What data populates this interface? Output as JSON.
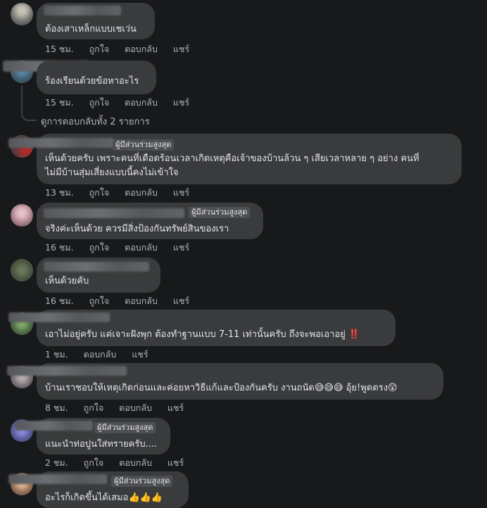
{
  "comments": [
    {
      "text_lines": [
        "ต้องเสาเหล็กแบบเชเว่น"
      ],
      "time": "15 ชม.",
      "like": "ถูกใจ",
      "reply": "ตอบกลับ",
      "share": "แชร์"
    },
    {
      "text_lines": [
        "ร้องเรียนด้วยข้อหาอะไร"
      ],
      "time": "15 ชม.",
      "like": "ถูกใจ",
      "reply": "ตอบกลับ",
      "share": "แชร์",
      "view_replies": "ดูการตอบกลับทั้ง 2 รายการ"
    },
    {
      "badge": "ผู้มีส่วนร่วมสูงสุด",
      "text_lines": [
        "เห็นด้วยครับ เพราะคนที่เดือดร้อนเวลาเกิดเหตุคือเจ้าของบ้านล้วน ๆ เสียเวลาหลาย ๆ อย่าง คนที่",
        "ไม่มีบ้านสุ่มเสี่ยงแบบนี้คงไม่เข้าใจ"
      ],
      "time": "13 ชม.",
      "like": "ถูกใจ",
      "reply": "ตอบกลับ",
      "share": "แชร์"
    },
    {
      "badge": "ผู้มีส่วนร่วมสูงสุด",
      "text_lines": [
        "จริงค่ะเห็นด้วย ควรมีสิ่งป้องกันทรัพย์สินของเรา"
      ],
      "time": "16 ชม.",
      "like": "ถูกใจ",
      "reply": "ตอบกลับ",
      "share": "แชร์"
    },
    {
      "text_lines": [
        "เห็นด้วยคับ"
      ],
      "time": "16 ชม.",
      "like": "ถูกใจ",
      "reply": "ตอบกลับ",
      "share": "แชร์"
    },
    {
      "text_lines": [
        "เอาไม่อยู่ครับ แค่เจาะฝังพุก ต้องทำฐานแบบ 7-11 เท่านั้นครับ ถึงจะพอเอาอยู่ ‼️"
      ],
      "time": "1 ชม.",
      "like": "",
      "reply": "ตอบกลับ",
      "share": "แชร์"
    },
    {
      "text_lines": [
        "บ้านเราชอบให้เหตุเกิดก่อนและค่อยหาวิธีแก้และป้องกันครับ งานถนัด😅😅😅 อุ้ย!พูดตรง😲"
      ],
      "time": "8 ชม.",
      "like": "ถูกใจ",
      "reply": "ตอบกลับ",
      "share": "แชร์"
    },
    {
      "badge": "ผู้มีส่วนร่วมสูงสุด",
      "text_lines": [
        "แนะนำท่อปูนใส่ทรายครับ...."
      ],
      "time": "2 ชม.",
      "like": "ถูกใจ",
      "reply": "ตอบกลับ",
      "share": "แชร์"
    },
    {
      "badge": "ผู้มีส่วนร่วมสูงสุด",
      "text_lines": [
        "อะไรก็เกิดขึ้นได้เสมอ👍👍👍"
      ]
    }
  ],
  "colors": {
    "background": "#18191a",
    "bubble": "#3a3b3c",
    "text": "#e4e6eb",
    "secondary_text": "#b0b3b8",
    "badge_bg": "#4e4f50"
  }
}
